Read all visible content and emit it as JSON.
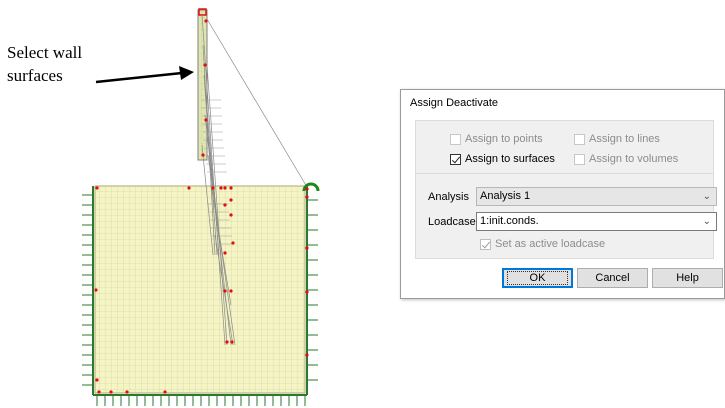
{
  "annotation": {
    "line1": "Select wall",
    "line2": "surfaces"
  },
  "viewport": {
    "mesh_fill_color": "#f4f4c4",
    "mesh_line_color": "#c9c99a",
    "support_color": "#2a7a2a",
    "point_color": "#e01010",
    "wall_line_color": "#808080"
  },
  "dialog": {
    "title": "Assign Deactivate",
    "checkboxes": [
      {
        "label": "Assign to points",
        "checked": false,
        "enabled": false
      },
      {
        "label": "Assign to lines",
        "checked": false,
        "enabled": false
      },
      {
        "label": "Assign to surfaces",
        "checked": true,
        "enabled": true
      },
      {
        "label": "Assign to volumes",
        "checked": false,
        "enabled": false
      }
    ],
    "analysis_label": "Analysis",
    "analysis_value": "Analysis 1",
    "loadcase_label": "Loadcase",
    "loadcase_value": "1:init.conds.",
    "set_active_label": "Set as active loadcase",
    "set_active_checked": true,
    "ok_label": "OK",
    "cancel_label": "Cancel",
    "help_label": "Help"
  }
}
